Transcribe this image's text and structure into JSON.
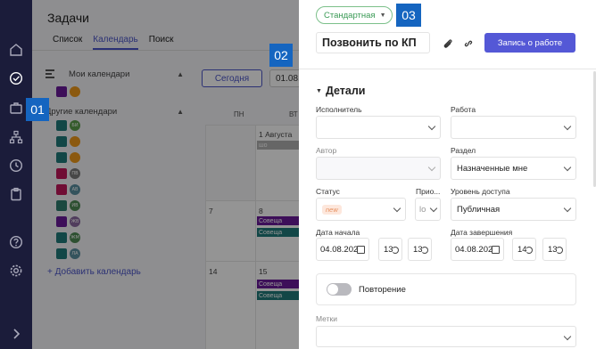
{
  "app": {
    "title": "Задачи",
    "tabs": [
      "Список",
      "Календарь",
      "Поиск"
    ],
    "active_tab": "Календарь"
  },
  "calendar": {
    "my_calendars_label": "Мои календари",
    "other_calendars_label": "Другие календари",
    "add_calendar_label": "+ Добавить календарь",
    "today_button": "Сегодня",
    "date_value": "01.08.",
    "weekdays": [
      "ПН",
      "ВТ"
    ],
    "day_numbers": [
      "1 Августа",
      "7",
      "8",
      "14",
      "15"
    ],
    "events": [
      "шо",
      "Совеща",
      "Совеща",
      "Совеща",
      "Совеща"
    ],
    "other_calendar_colors": [
      "#1f7a7a",
      "#1f7a7a",
      "#1f7a7a",
      "#c2185b",
      "#c2185b",
      "#2e7d6e",
      "#6a1b9a",
      "#1f7a7a",
      "#1f7a7a"
    ],
    "avatar_initials": [
      "БИ",
      "",
      "",
      "ПВ",
      "АВ",
      "ИВ",
      "ЖВ",
      "ЖМ",
      "ЛА"
    ],
    "avatar_colors": [
      "#5a9e4a",
      "#f09a1a",
      "#f09a1a",
      "#7a7a7a",
      "#5a8fa0",
      "#4f8a55",
      "#8a6aa0",
      "#4f8a55",
      "#5a8fa0"
    ]
  },
  "badges": {
    "b1": "01",
    "b2": "02",
    "b3": "03"
  },
  "task": {
    "type_label": "Стандартная",
    "title": "Позвонить по КП",
    "submit_label": "Запись о работе",
    "section_title": "Детали",
    "fields": {
      "assignee_label": "Исполнитель",
      "assignee_value": "",
      "work_label": "Работа",
      "work_value": "",
      "author_label": "Автор",
      "author_value": "",
      "section_label": "Раздел",
      "section_value": "Назначенные мне",
      "status_label": "Статус",
      "status_value": "new",
      "priority_label": "Прио...",
      "priority_value": "lo",
      "access_label": "Уровень доступа",
      "access_value": "Публичная",
      "start_label": "Дата начала",
      "start_date": "04.08.202",
      "start_hour": "13",
      "start_min": "13",
      "end_label": "Дата завершения",
      "end_date": "04.08.202",
      "end_hour": "14",
      "end_min": "13"
    },
    "repeat_label": "Повторение",
    "tags_label": "Метки"
  },
  "colors": {
    "accent": "#5458d6",
    "rail": "#1b1c3a",
    "badge": "#1565c0"
  }
}
